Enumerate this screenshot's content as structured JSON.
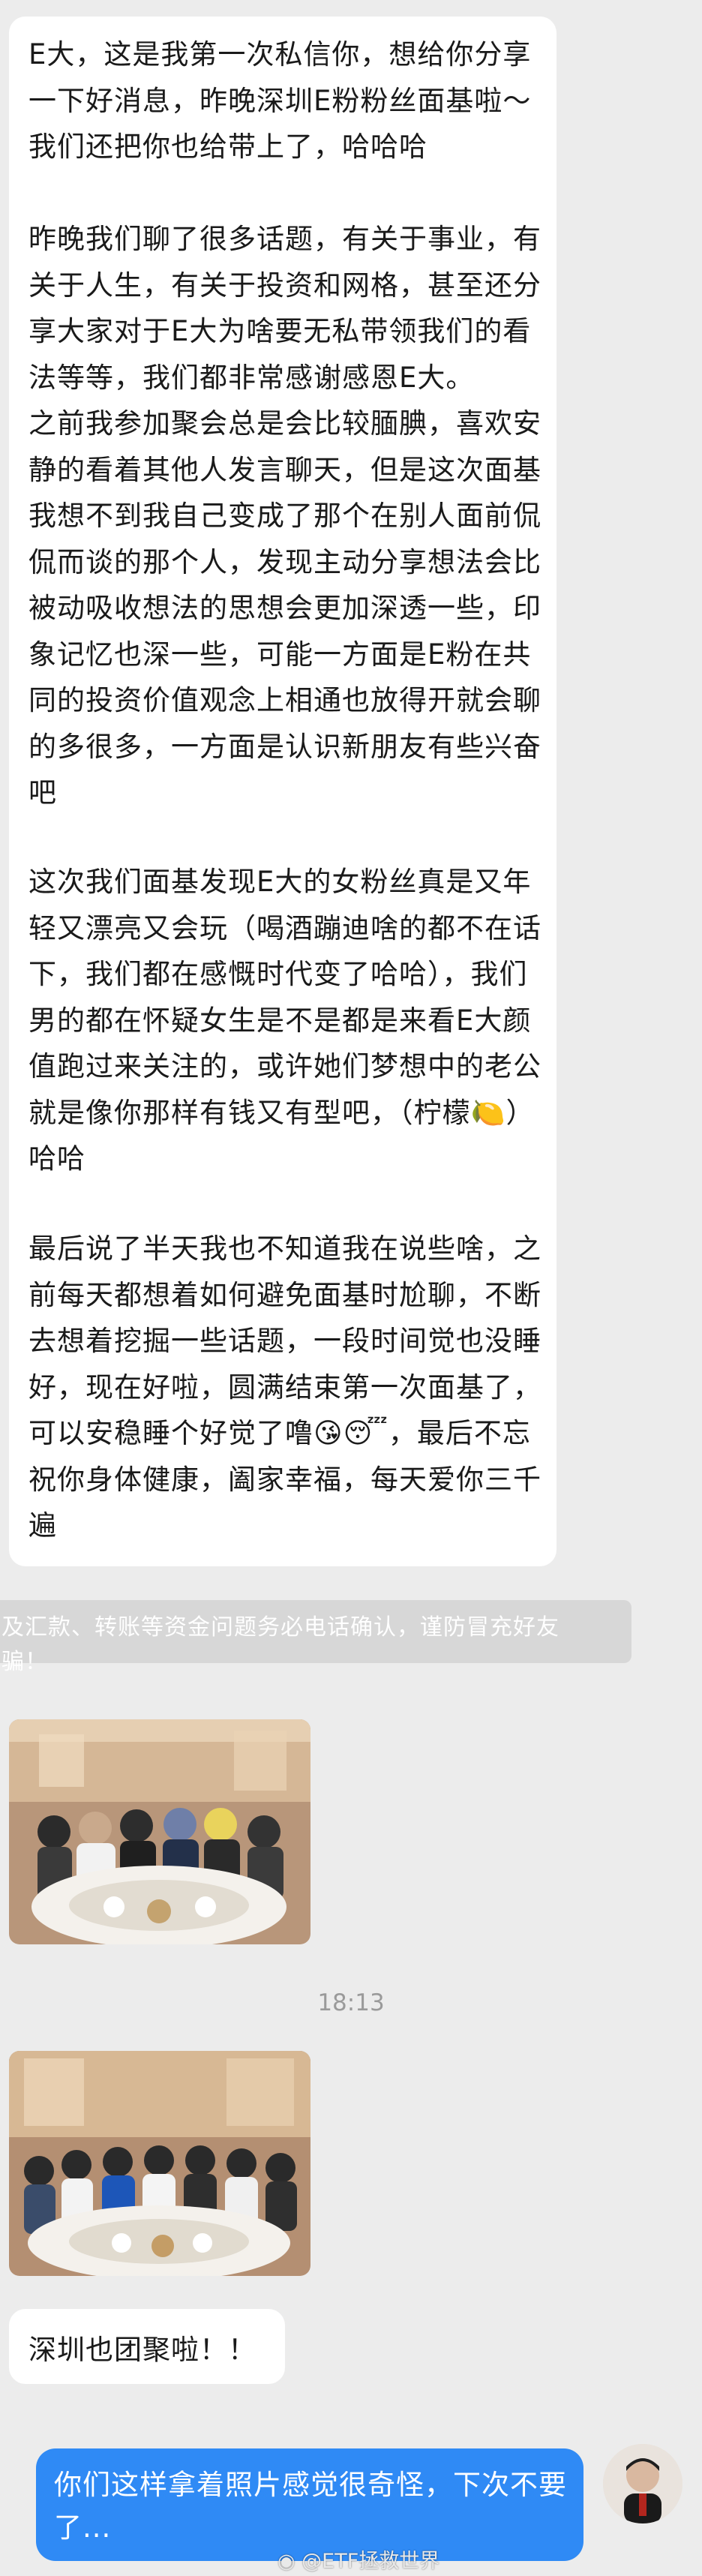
{
  "messages": {
    "first": {
      "paragraphs": [
        "E大，这是我第一次私信你，想给你分享一下好消息，昨晚深圳E粉粉丝面基啦～我们还把你也给带上了，哈哈哈",
        "昨晚我们聊了很多话题，有关于事业，有关于人生，有关于投资和网格，甚至还分享大家对于E大为啥要无私带领我们的看法等等，我们都非常感谢感恩E大。",
        "之前我参加聚会总是会比较腼腆，喜欢安静的看着其他人发言聊天，但是这次面基我想不到我自己变成了那个在别人面前侃侃而谈的那个人，发现主动分享想法会比被动吸收想法的思想会更加深透一些，印象记忆也深一些，可能一方面是E粉在共同的投资价值观念上相通也放得开就会聊的多很多，一方面是认识新朋友有些兴奋吧",
        "这次我们面基发现E大的女粉丝真是又年轻又漂亮又会玩（喝酒蹦迪啥的都不在话下，我们都在感慨时代变了哈哈），我们男的都在怀疑女生是不是都是来看E大颜值跑过来关注的，或许她们梦想中的老公就是像你那样有钱又有型吧，（柠檬🍋）哈哈",
        "最后说了半天我也不知道我在说些啥，之前每天都想着如何避免面基时尬聊，不断去想着挖掘一些话题，一段时间觉也没睡好，现在好啦，圆满结束第一次面基了，可以安稳睡个好觉了噜😘😴，最后不忘祝你身体健康，阖家幸福，每天爱你三千遍"
      ]
    },
    "notice": "及汇款、转账等资金问题务必电话确认，谨防冒充好友骗！",
    "timestamp": "18:13",
    "second": "深圳也团聚啦！！",
    "reply": "你们这样拿着照片感觉很奇怪，下次不要了..."
  },
  "watermark": "@ETF拯救世界",
  "colors": {
    "background": "#ececec",
    "incoming_bubble": "#ffffff",
    "outgoing_bubble": "#2f8af5",
    "notice_bar": "#d7d7d7"
  },
  "icons": [
    "weibo-logo-icon"
  ]
}
